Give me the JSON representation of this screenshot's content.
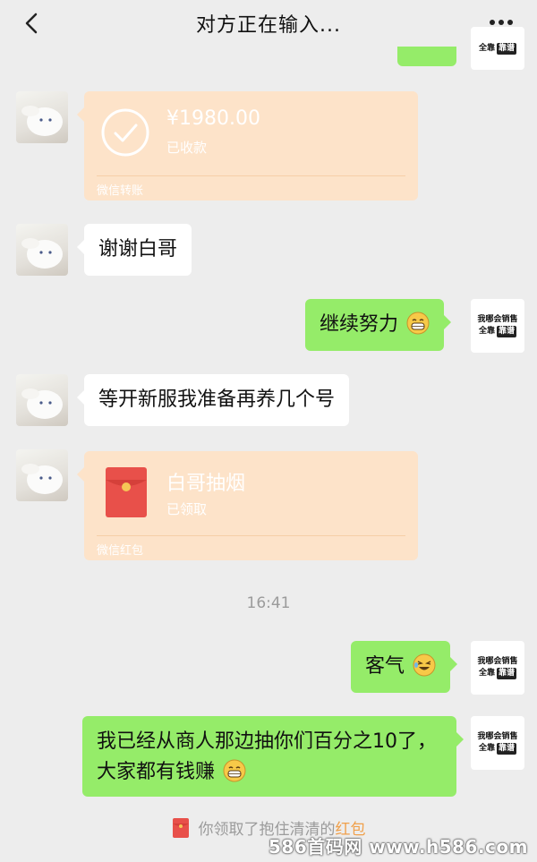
{
  "header": {
    "title": "对方正在输入...",
    "back_icon": "chevron-left-icon",
    "more_icon": "more-dots-icon"
  },
  "my_avatar": {
    "line1": "我哪会销售",
    "line2_prefix": "全靠",
    "line2_tag": "靠谱"
  },
  "messages": {
    "transfer": {
      "amount": "¥1980.00",
      "status": "已收款",
      "footer": "微信转账"
    },
    "thanks": "谢谢白哥",
    "keep_going": "继续努力",
    "new_server": "等开新服我准备再养几个号",
    "red_packet": {
      "title": "白哥抽烟",
      "status": "已领取",
      "footer": "微信红包"
    },
    "timestamp": "16:41",
    "polite": "客气",
    "commission": "我已经从商人那边抽你们百分之10了，大家都有钱赚"
  },
  "notice": {
    "text": "你领取了抱住清清的",
    "link": "红包"
  },
  "watermark": "586首码网 www.h586.com",
  "colors": {
    "background": "#ededed",
    "my_bubble": "#95ec69",
    "their_bubble": "#ffffff",
    "card_bg": "#fde3c9",
    "red_packet": "#e8504a"
  }
}
